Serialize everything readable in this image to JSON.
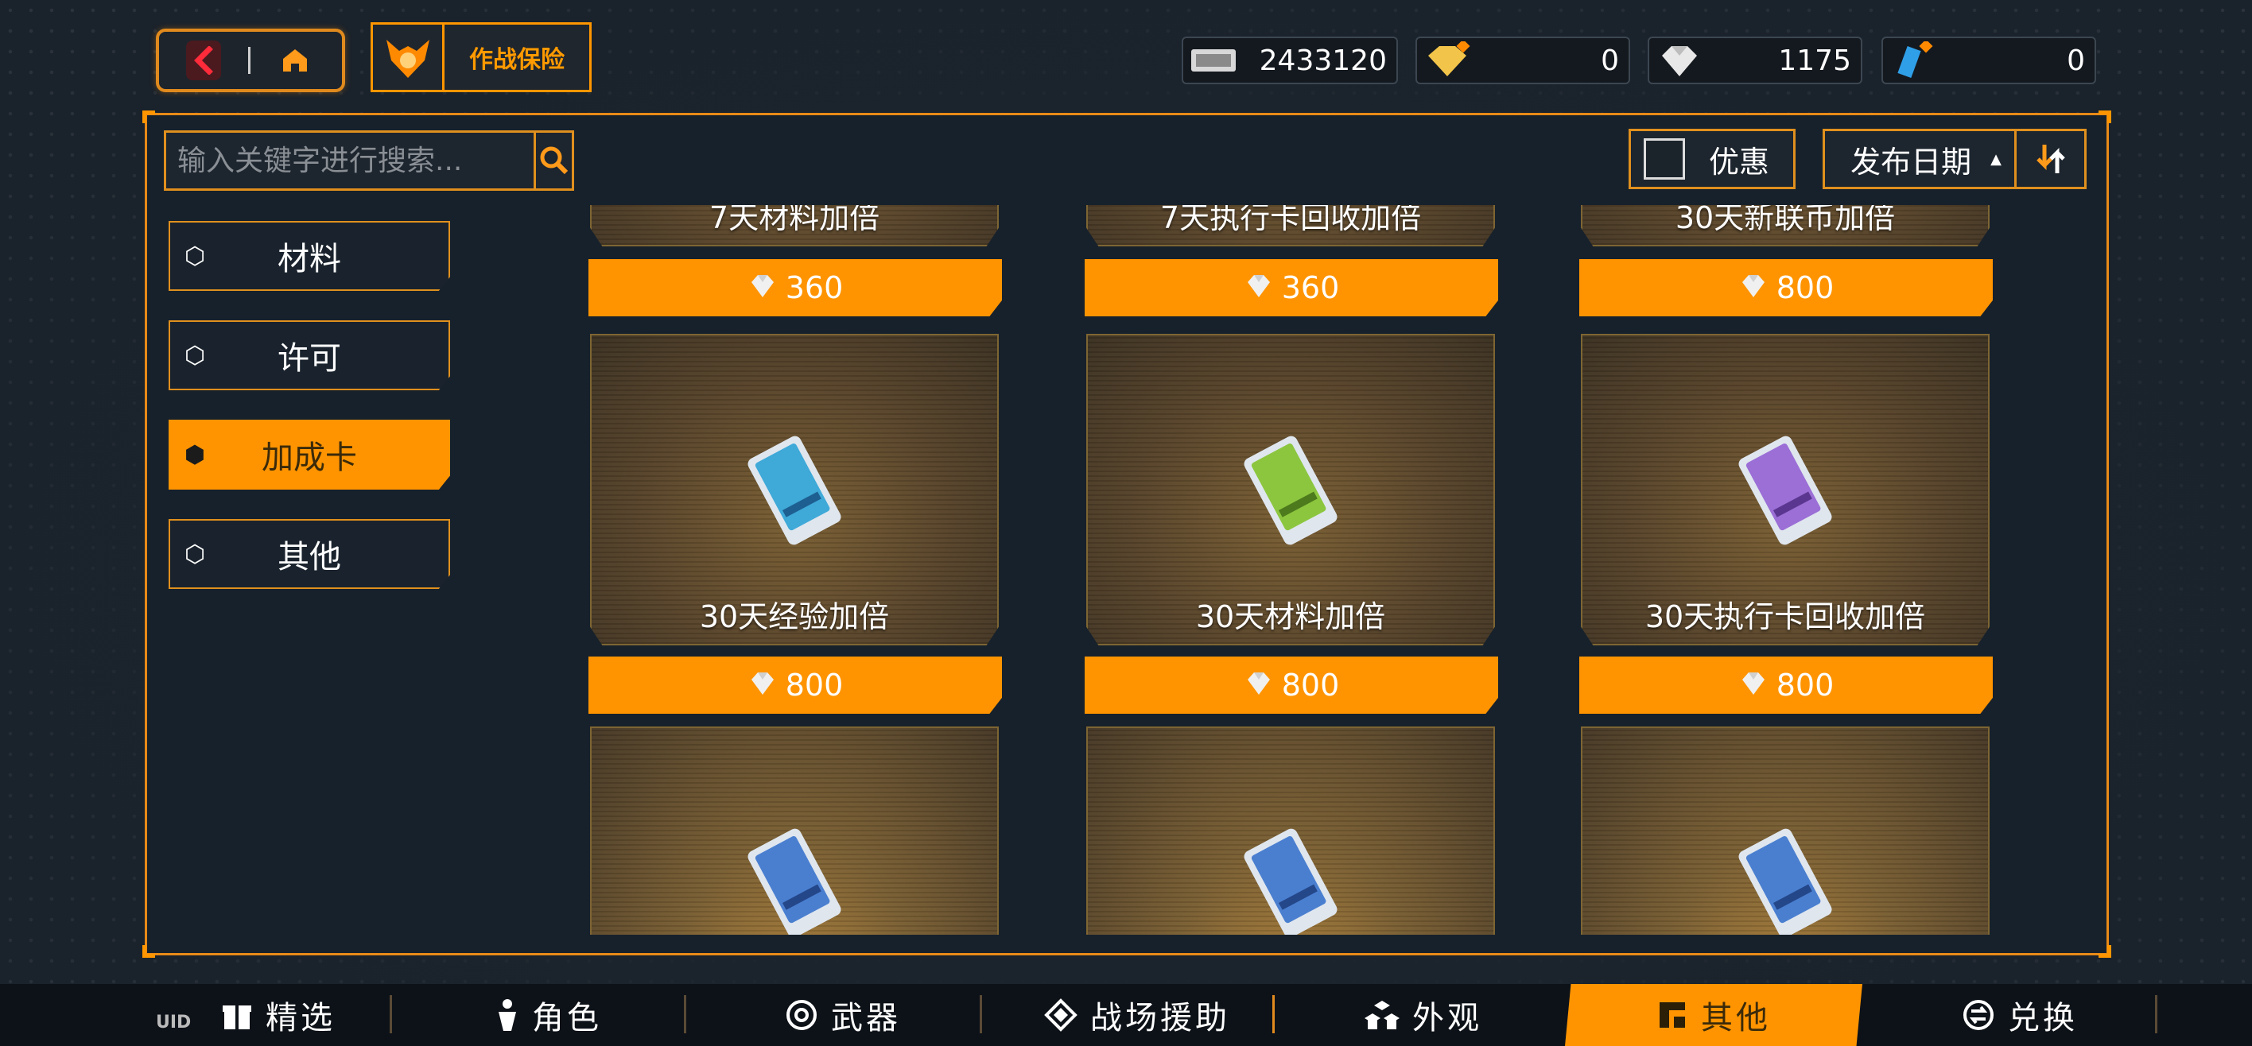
{
  "topbar": {
    "back_icon": "chevron-left-icon",
    "home_icon": "home-icon",
    "insurance_label": "作战保险",
    "currencies": [
      {
        "icon": "ticket-icon",
        "value": "2433120"
      },
      {
        "icon": "gold-diamond-icon",
        "value": "0"
      },
      {
        "icon": "diamond-icon",
        "value": "1175"
      },
      {
        "icon": "blue-crystal-icon",
        "value": "0"
      }
    ]
  },
  "search": {
    "placeholder": "输入关键字进行搜索..."
  },
  "filter": {
    "discount_label": "优惠",
    "sort_label": "发布日期"
  },
  "categories": [
    {
      "label": "材料",
      "active": false
    },
    {
      "label": "许可",
      "active": false
    },
    {
      "label": "加成卡",
      "active": true
    },
    {
      "label": "其他",
      "active": false
    }
  ],
  "items": {
    "row1": [
      {
        "name": "7天材料加倍",
        "price": "360"
      },
      {
        "name": "7天执行卡回收加倍",
        "price": "360"
      },
      {
        "name": "30天新联币加倍",
        "price": "800"
      }
    ],
    "row2": [
      {
        "name": "30天经验加倍",
        "price": "800",
        "card_color": "#3fa9d8"
      },
      {
        "name": "30天材料加倍",
        "price": "800",
        "card_color": "#8cc63f"
      },
      {
        "name": "30天执行卡回收加倍",
        "price": "800",
        "card_color": "#9b6fd6"
      }
    ],
    "row3": [
      {
        "card_color": "#4a7fd0"
      },
      {
        "card_color": "#4a7fd0"
      },
      {
        "card_color": "#4a7fd0"
      }
    ]
  },
  "tabs": [
    {
      "label": "精选",
      "icon": "gift-icon",
      "active": false
    },
    {
      "label": "角色",
      "icon": "person-icon",
      "active": false
    },
    {
      "label": "武器",
      "icon": "target-icon",
      "active": false
    },
    {
      "label": "战场援助",
      "icon": "support-icon",
      "active": false
    },
    {
      "label": "外观",
      "icon": "cubes-icon",
      "active": false
    },
    {
      "label": "其他",
      "icon": "other-icon",
      "active": true
    },
    {
      "label": "兑换",
      "icon": "exchange-icon",
      "active": false
    }
  ],
  "uid_label": "UID",
  "colors": {
    "accent": "#ff9400",
    "frame": "#e88a18",
    "background": "#17212b"
  }
}
